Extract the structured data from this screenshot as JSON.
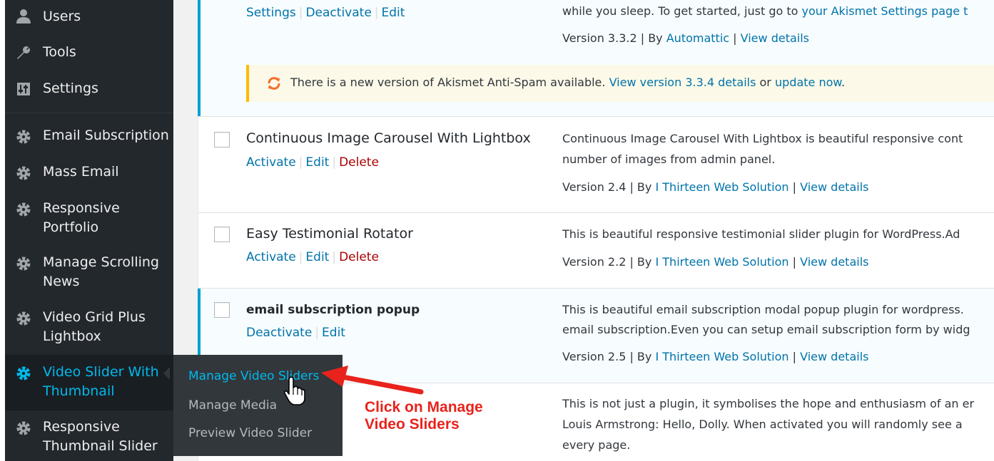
{
  "sidebar": {
    "items": [
      {
        "label": "Users",
        "icon": "users-icon"
      },
      {
        "label": "Tools",
        "icon": "wrench-icon"
      },
      {
        "label": "Settings",
        "icon": "settings-icon"
      },
      {
        "label": "Email Subscription",
        "icon": "gear-icon"
      },
      {
        "label": "Mass Email",
        "icon": "gear-icon"
      },
      {
        "label": "Responsive Portfolio",
        "icon": "gear-icon"
      },
      {
        "label": "Manage Scrolling News",
        "icon": "gear-icon"
      },
      {
        "label": "Video Grid Plus Lightbox",
        "icon": "gear-icon"
      },
      {
        "label": "Video Slider With Thumbnail",
        "icon": "gear-icon",
        "active": true
      },
      {
        "label": "Responsive Thumbnail Slider",
        "icon": "gear-icon"
      }
    ],
    "flyout": [
      {
        "label": "Manage Video Sliders",
        "current": true
      },
      {
        "label": "Manage Media"
      },
      {
        "label": "Preview Video Slider"
      }
    ]
  },
  "plugins": {
    "akismet": {
      "actions": [
        "Settings",
        "Deactivate",
        "Edit"
      ],
      "desc_line": "while you sleep. To get started, just go to",
      "desc_link": "your Akismet Settings page t",
      "version": "Version 3.3.2 | By",
      "author": "Automattic",
      "view_details": "View details",
      "notice_text": "There is a new version of Akismet Anti-Spam available.",
      "notice_link1": "View version 3.3.4 details",
      "notice_or": "or",
      "notice_link2": "update now",
      "notice_dot": "."
    },
    "carousel": {
      "name": "Continuous Image Carousel With Lightbox",
      "actions": [
        "Activate",
        "Edit",
        "Delete"
      ],
      "desc1": "Continuous Image Carousel With Lightbox is beautiful responsive cont",
      "desc2": "number of images from admin panel.",
      "version": "Version 2.4 | By",
      "author": "I Thirteen Web Solution",
      "view_details": "View details"
    },
    "testimonial": {
      "name": "Easy Testimonial Rotator",
      "actions": [
        "Activate",
        "Edit",
        "Delete"
      ],
      "desc1": "This is beautiful responsive testimonial slider plugin for WordPress.Ad",
      "version": "Version 2.2 | By",
      "author": "I Thirteen Web Solution",
      "view_details": "View details"
    },
    "popup": {
      "name": "email subscription popup",
      "actions": [
        "Deactivate",
        "Edit"
      ],
      "desc1": "This is beautiful email subscription modal popup plugin for wordpress.",
      "desc2": "email subscription.Even you can setup email subscription form by widg",
      "version": "Version 2.5 | By",
      "author": "I Thirteen Web Solution",
      "view_details": "View details"
    },
    "dolly": {
      "desc1": "This is not just a plugin, it symbolises the hope and enthusiasm of an er",
      "desc2": "Louis Armstrong: Hello, Dolly. When activated you will randomly see a",
      "desc3": "every page."
    }
  },
  "annotation": {
    "line1": "Click on Manage",
    "line2": "Video Sliders",
    "color": "#e8231c"
  },
  "colors": {
    "sidebar_bg": "#23282d",
    "flyout_bg": "#32373c",
    "accent": "#00b9eb",
    "link": "#0073aa",
    "delete": "#aa0000",
    "notice_border": "#ffb900",
    "active_border": "#00a0d2"
  }
}
